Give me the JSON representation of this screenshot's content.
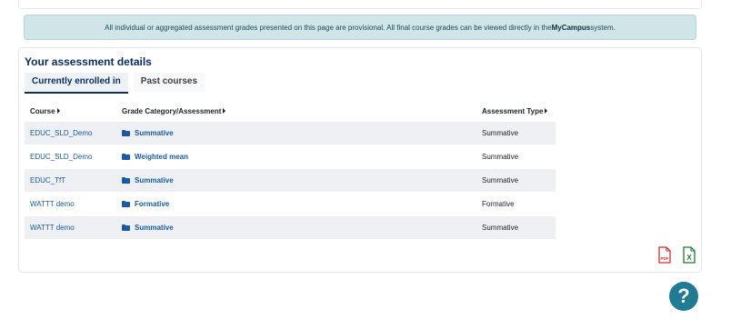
{
  "notice": {
    "text_before": "All individual or aggregated assessment grades presented on this page are provisional. All final course grades can be viewed directly in the ",
    "system_name": "MyCampus",
    "text_after": " system."
  },
  "section": {
    "title": "Your assessment details",
    "tabs": [
      {
        "label": "Currently enrolled in",
        "active": true
      },
      {
        "label": "Past courses",
        "active": false
      }
    ]
  },
  "table": {
    "columns": [
      "Course",
      "Grade Category/Assessment",
      "Assessment Type"
    ],
    "rows": [
      {
        "course": "EDUC_SLD_Demo",
        "category": "Summative",
        "type": "Summative"
      },
      {
        "course": "EDUC_SLD_Demo",
        "category": "Weighted mean",
        "type": "Summative"
      },
      {
        "course": "EDUC_TfT",
        "category": "Summative",
        "type": "Summative"
      },
      {
        "course": "WATTT demo",
        "category": "Formative",
        "type": "Formative"
      },
      {
        "course": "WATTT demo",
        "category": "Summative",
        "type": "Summative"
      }
    ]
  },
  "export": {
    "pdf_icon": "file-pdf-icon",
    "pdf_label": "PDF",
    "excel_icon": "file-excel-icon",
    "excel_label": "X"
  },
  "help": {
    "icon": "question-icon",
    "label": "?"
  },
  "colors": {
    "link": "#1a5aa6",
    "heading": "#0b2d63",
    "notice_bg": "#cfe5e8",
    "pdf": "#d32f2f",
    "excel": "#1e7b34",
    "help_bg": "#1f7c94"
  }
}
